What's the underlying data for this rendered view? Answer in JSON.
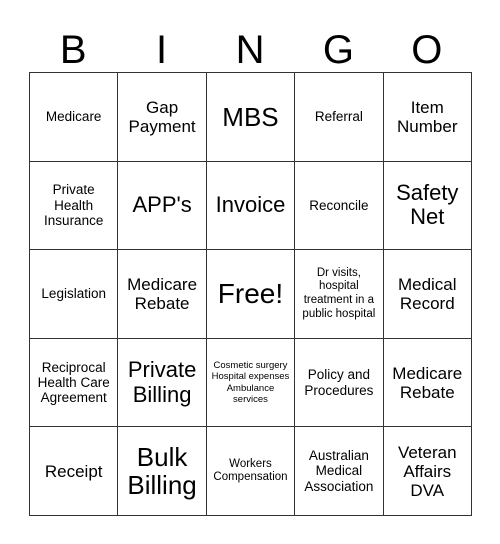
{
  "card": {
    "title": "BINGO",
    "header_letters": [
      "B",
      "I",
      "N",
      "G",
      "O"
    ],
    "rows": [
      [
        {
          "text": "Medicare",
          "size": "sz-md"
        },
        {
          "text": "Gap Payment",
          "size": "sz-lg"
        },
        {
          "text": "MBS",
          "size": "sz-xxl"
        },
        {
          "text": "Referral",
          "size": "sz-md"
        },
        {
          "text": "Item Number",
          "size": "sz-lg"
        }
      ],
      [
        {
          "text": "Private Health Insurance",
          "size": "sz-md"
        },
        {
          "text": "APP's",
          "size": "sz-xl"
        },
        {
          "text": "Invoice",
          "size": "sz-xl"
        },
        {
          "text": "Reconcile",
          "size": "sz-md"
        },
        {
          "text": "Safety Net",
          "size": "sz-xl"
        }
      ],
      [
        {
          "text": "Legislation",
          "size": "sz-md"
        },
        {
          "text": "Medicare Rebate",
          "size": "sz-lg"
        },
        {
          "text": "Free!",
          "size": "sz-free"
        },
        {
          "text": "Dr visits, hospital treatment in a public hospital",
          "size": "sz-sm"
        },
        {
          "text": "Medical Record",
          "size": "sz-lg"
        }
      ],
      [
        {
          "text": "Reciprocal Health Care Agreement",
          "size": "sz-md"
        },
        {
          "text": "Private Billing",
          "size": "sz-xl"
        },
        {
          "text": "Cosmetic surgery Hospital expenses Ambulance services",
          "size": "sz-xs"
        },
        {
          "text": "Policy and Procedures",
          "size": "sz-md"
        },
        {
          "text": "Medicare Rebate",
          "size": "sz-lg"
        }
      ],
      [
        {
          "text": "Receipt",
          "size": "sz-lg"
        },
        {
          "text": "Bulk Billing",
          "size": "sz-xxl"
        },
        {
          "text": "Workers Compensation",
          "size": "sz-sm"
        },
        {
          "text": "Australian Medical Association",
          "size": "sz-md"
        },
        {
          "text": "Veteran Affairs DVA",
          "size": "sz-lg"
        }
      ]
    ],
    "colors": {
      "background": "#ffffff",
      "text": "#000000",
      "grid_line": "#333333"
    }
  }
}
